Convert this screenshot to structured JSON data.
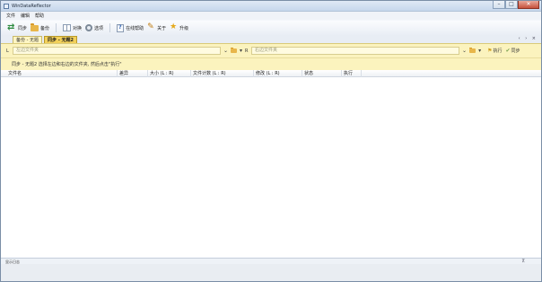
{
  "app": {
    "title": "WinDataReflector"
  },
  "window_controls": {
    "minimize": "–",
    "maximize": "□",
    "close": "✕"
  },
  "menu": [
    "文件",
    "编辑",
    "帮助"
  ],
  "toolbar": [
    {
      "label": "同步",
      "icon": "sync-icon"
    },
    {
      "label": "备份",
      "icon": "backup-folder-icon"
    },
    {
      "label": "对换",
      "icon": "compare-icon"
    },
    {
      "label": "选项",
      "icon": "gear-icon"
    },
    {
      "label": "在线帮助",
      "icon": "help-icon"
    },
    {
      "label": "关于",
      "icon": "wand-icon"
    },
    {
      "label": "升级",
      "icon": "star-icon"
    }
  ],
  "tabs": {
    "tab1": "备份 - 无题",
    "tab2": "同步 - 无题2",
    "nav": "‹ › ×"
  },
  "pathbar": {
    "left_side": "L",
    "left_placeholder": "左边文件夹",
    "right_side": "R",
    "right_placeholder": "右边文件夹",
    "run_label": "执行",
    "sync_label": "同步"
  },
  "info": {
    "text": "同步 - 无题2   选择左边和右边的文件夹, 然后点击\"执行\""
  },
  "columns": [
    "文件名",
    "差异",
    "大小 (L : R)",
    "文件计数 (L : R)",
    "修改 (L : R)",
    "状态",
    "执行"
  ],
  "log": {
    "title": "显示日志",
    "pin": "⊼"
  }
}
